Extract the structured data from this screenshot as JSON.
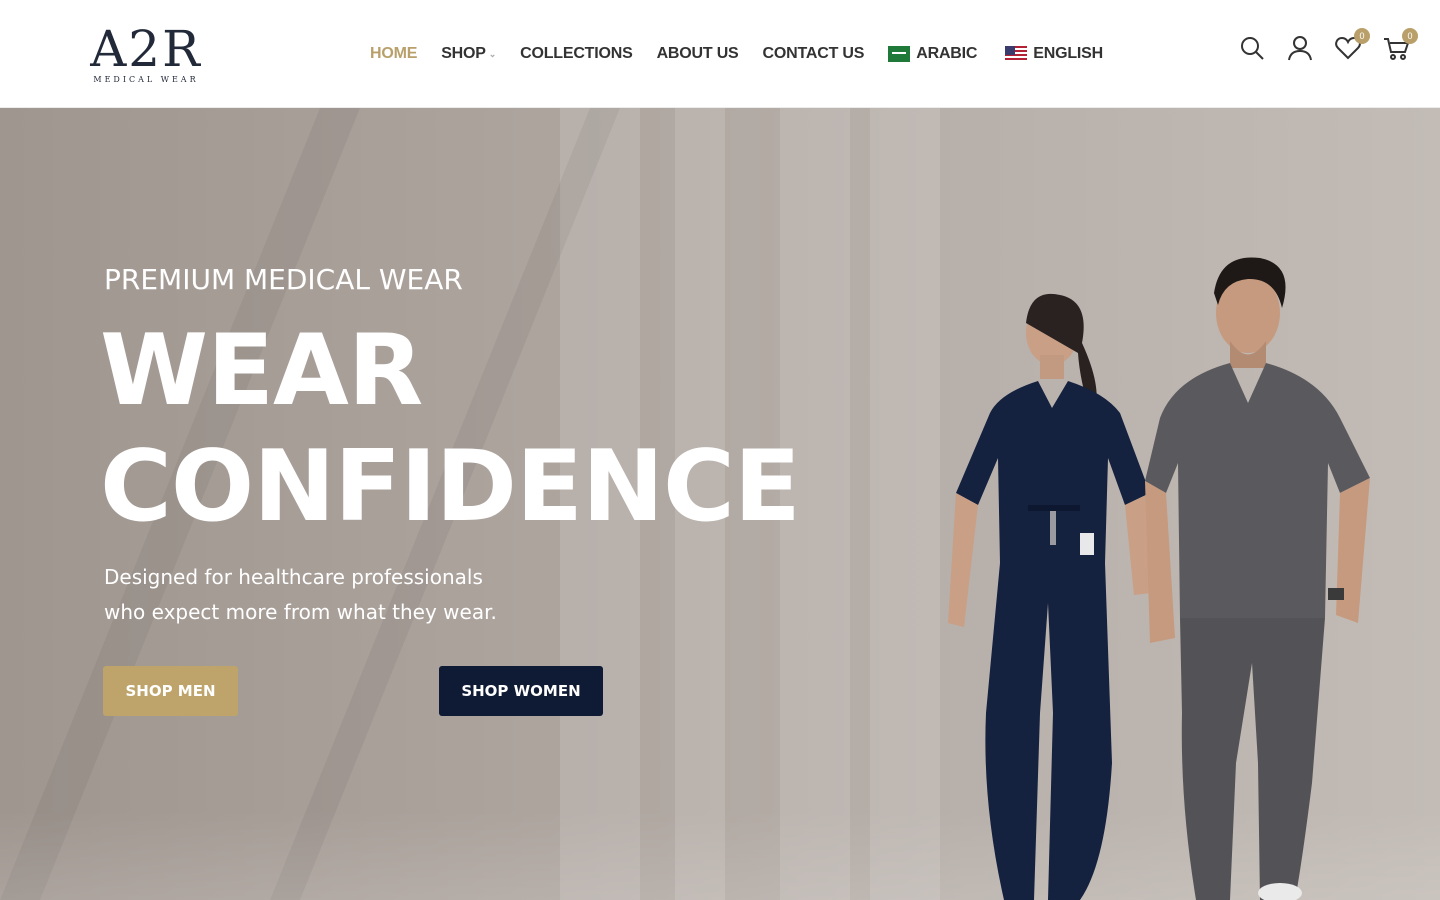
{
  "brand": {
    "logo_text": "A2R",
    "logo_subtext": "MEDICAL WEAR"
  },
  "nav": {
    "items": [
      {
        "label": "HOME",
        "active": true
      },
      {
        "label": "SHOP",
        "has_dropdown": true
      },
      {
        "label": "COLLECTIONS"
      },
      {
        "label": "ABOUT US"
      },
      {
        "label": "CONTACT US"
      },
      {
        "label": "ARABIC",
        "flag": "saudi-flag"
      },
      {
        "label": "ENGLISH",
        "flag": "us-flag"
      }
    ]
  },
  "header_icons": {
    "search": "search-icon",
    "account": "user-icon",
    "wishlist": {
      "icon": "heart-icon",
      "count": "0"
    },
    "cart": {
      "icon": "cart-icon",
      "count": "0"
    }
  },
  "hero": {
    "eyebrow": "PREMIUM MEDICAL WEAR",
    "headline_line1": "WEAR",
    "headline_line2": "CONFIDENCE",
    "subtitle_line1": "Designed for healthcare professionals",
    "subtitle_line2": "who expect more from what they wear.",
    "cta_men": "SHOP MEN",
    "cta_women": "SHOP WOMEN"
  },
  "colors": {
    "accent_gold": "#b9a06b",
    "navy": "#0f1a35",
    "nav_text": "#333333"
  }
}
